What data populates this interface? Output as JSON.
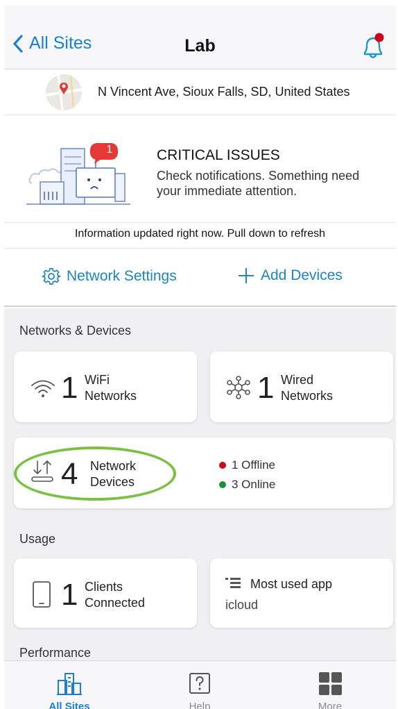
{
  "header": {
    "back_label": "All Sites",
    "title": "Lab"
  },
  "address": {
    "text": "N Vincent Ave, Sioux Falls, SD, United States"
  },
  "issues": {
    "badge_count": "1",
    "title": "CRITICAL ISSUES",
    "description": "Check notifications. Something need your immediate attention."
  },
  "refresh_note": "Information updated right now. Pull down to refresh",
  "actions": {
    "network_settings": "Network Settings",
    "add_devices": "Add Devices"
  },
  "sections": {
    "networks_devices": "Networks & Devices",
    "usage": "Usage",
    "performance": "Performance"
  },
  "cards": {
    "wifi": {
      "count": "1",
      "line1": "WiFi",
      "line2": "Networks"
    },
    "wired": {
      "count": "1",
      "line1": "Wired",
      "line2": "Networks"
    },
    "network_devices": {
      "count": "4",
      "line1": "Network",
      "line2": "Devices",
      "offline": "1 Offline",
      "online": "3 Online"
    },
    "clients": {
      "count": "1",
      "line1": "Clients",
      "line2": "Connected"
    },
    "most_used": {
      "title": "Most used app",
      "value": "icloud"
    }
  },
  "tabs": [
    {
      "label": "All Sites",
      "icon": "buildings-icon",
      "active": true
    },
    {
      "label": "Help",
      "icon": "help-icon",
      "active": false
    },
    {
      "label": "More",
      "icon": "grid-icon",
      "active": false
    }
  ],
  "colors": {
    "accent": "#1a7fd4",
    "link": "#1d84bd",
    "offline": "#d0021b",
    "online": "#1e8e3e",
    "highlight": "#7ac142"
  }
}
